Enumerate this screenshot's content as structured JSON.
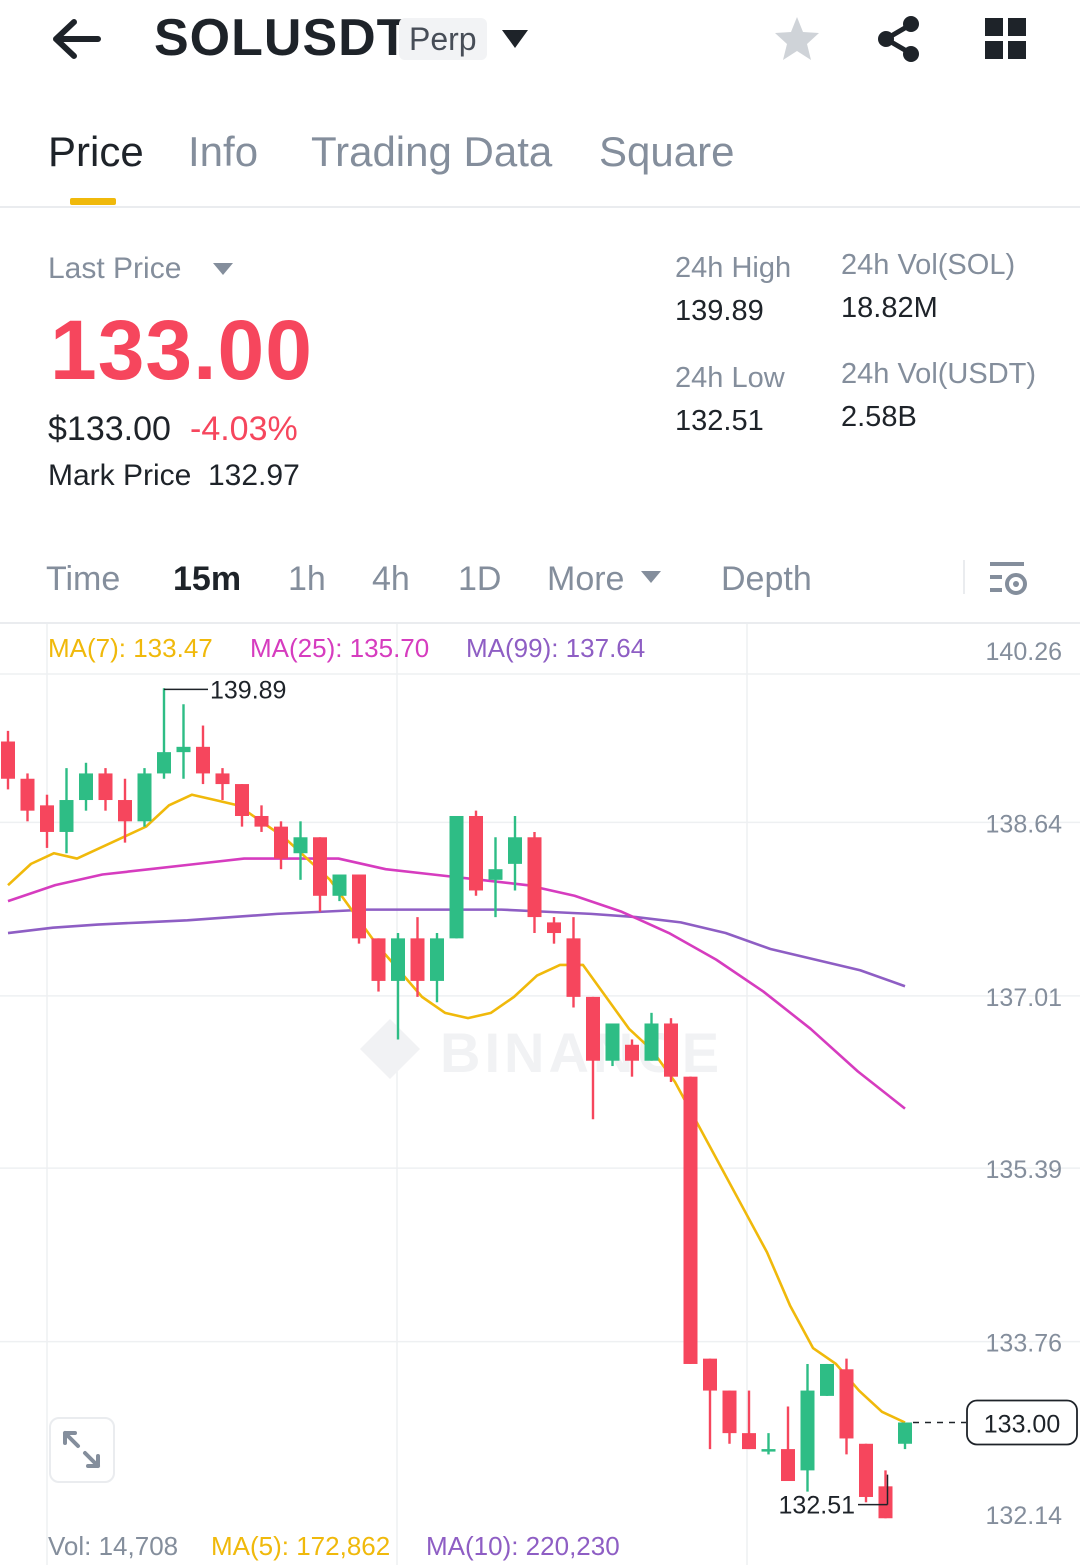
{
  "header": {
    "symbol": "SOLUSDT",
    "badge": "Perp",
    "icons": [
      "back-arrow-icon",
      "caret-down-icon",
      "star-icon",
      "share-icon",
      "grid-icon"
    ]
  },
  "tabs": [
    {
      "label": "Price",
      "active": true
    },
    {
      "label": "Info",
      "active": false
    },
    {
      "label": "Trading Data",
      "active": false
    },
    {
      "label": "Square",
      "active": false
    }
  ],
  "price": {
    "last_price_label": "Last Price",
    "last_price": "133.00",
    "usd_price": "$133.00",
    "change_pct": "-4.03%",
    "mark_price_label": "Mark Price",
    "mark_price": "132.97"
  },
  "stats": {
    "high_label": "24h High",
    "high": "139.89",
    "low_label": "24h Low",
    "low": "132.51",
    "vol_sol_label": "24h Vol(SOL)",
    "vol_sol": "18.82M",
    "vol_usdt_label": "24h Vol(USDT)",
    "vol_usdt": "2.58B"
  },
  "intervals": [
    {
      "label": "Time",
      "active": false
    },
    {
      "label": "15m",
      "active": true
    },
    {
      "label": "1h",
      "active": false
    },
    {
      "label": "4h",
      "active": false
    },
    {
      "label": "1D",
      "active": false
    },
    {
      "label": "More",
      "active": false
    },
    {
      "label": "Depth",
      "active": false
    }
  ],
  "legend": {
    "ma7": "MA(7): 133.47",
    "ma25": "MA(25): 135.70",
    "ma99": "MA(99): 137.64",
    "vol": "Vol: 14,708",
    "vol_ma5": "MA(5): 172,862",
    "vol_ma10": "MA(10): 220,230"
  },
  "colors": {
    "up": "#2ebd85",
    "down": "#f6465d",
    "accent": "#f0b90b",
    "ma7": "#f0b90b",
    "ma25": "#d63cbf",
    "ma99": "#8e5ec4"
  },
  "chart_data": {
    "type": "candlestick",
    "watermark": "BINANCE",
    "y_ticks": [
      "140.26",
      "138.64",
      "137.01",
      "135.39",
      "133.76",
      "132.14"
    ],
    "ylim": [
      132.14,
      140.26
    ],
    "high_marker": "139.89",
    "low_marker": "132.51",
    "current_price": "133.00",
    "candles": [
      {
        "o": 139.4,
        "h": 139.5,
        "c": 139.05,
        "l": 138.95
      },
      {
        "o": 139.05,
        "h": 139.1,
        "c": 138.75,
        "l": 138.65
      },
      {
        "o": 138.8,
        "h": 138.9,
        "c": 138.55,
        "l": 138.4
      },
      {
        "o": 138.55,
        "h": 139.15,
        "c": 138.85,
        "l": 138.35
      },
      {
        "o": 138.85,
        "h": 139.2,
        "c": 139.1,
        "l": 138.75
      },
      {
        "o": 139.1,
        "h": 139.15,
        "c": 138.85,
        "l": 138.75
      },
      {
        "o": 138.85,
        "h": 139.05,
        "c": 138.65,
        "l": 138.45
      },
      {
        "o": 138.65,
        "h": 139.15,
        "c": 139.1,
        "l": 138.6
      },
      {
        "o": 139.1,
        "h": 139.9,
        "c": 139.3,
        "l": 139.05
      },
      {
        "o": 139.3,
        "h": 139.75,
        "c": 139.35,
        "l": 139.05
      },
      {
        "o": 139.35,
        "h": 139.55,
        "c": 139.1,
        "l": 139.0
      },
      {
        "o": 139.1,
        "h": 139.15,
        "c": 139.0,
        "l": 138.85
      },
      {
        "o": 139.0,
        "h": 139.0,
        "c": 138.7,
        "l": 138.6
      },
      {
        "o": 138.7,
        "h": 138.8,
        "c": 138.6,
        "l": 138.55
      },
      {
        "o": 138.6,
        "h": 138.65,
        "c": 138.3,
        "l": 138.2
      },
      {
        "o": 138.35,
        "h": 138.65,
        "c": 138.5,
        "l": 138.1
      },
      {
        "o": 138.5,
        "h": 138.5,
        "c": 137.95,
        "l": 137.8
      },
      {
        "o": 137.95,
        "h": 138.15,
        "c": 138.15,
        "l": 137.9
      },
      {
        "o": 138.15,
        "h": 138.15,
        "c": 137.55,
        "l": 137.5
      },
      {
        "o": 137.55,
        "h": 137.55,
        "c": 137.15,
        "l": 137.05
      },
      {
        "o": 137.15,
        "h": 137.6,
        "c": 137.55,
        "l": 136.6
      },
      {
        "o": 137.55,
        "h": 137.75,
        "c": 137.15,
        "l": 137.0
      },
      {
        "o": 137.15,
        "h": 137.6,
        "c": 137.55,
        "l": 136.95
      },
      {
        "o": 137.55,
        "h": 138.7,
        "c": 138.7,
        "l": 137.55
      },
      {
        "o": 138.7,
        "h": 138.75,
        "c": 138.0,
        "l": 137.95
      },
      {
        "o": 138.1,
        "h": 138.5,
        "c": 138.2,
        "l": 137.75
      },
      {
        "o": 138.25,
        "h": 138.7,
        "c": 138.5,
        "l": 138.0
      },
      {
        "o": 138.5,
        "h": 138.55,
        "c": 137.75,
        "l": 137.6
      },
      {
        "o": 137.7,
        "h": 137.75,
        "c": 137.6,
        "l": 137.5
      },
      {
        "o": 137.55,
        "h": 137.75,
        "c": 137.0,
        "l": 136.9
      },
      {
        "o": 137.0,
        "h": 137.0,
        "c": 136.4,
        "l": 135.85
      },
      {
        "o": 136.4,
        "h": 136.7,
        "c": 136.75,
        "l": 136.35
      },
      {
        "o": 136.55,
        "h": 136.6,
        "c": 136.4,
        "l": 136.25
      },
      {
        "o": 136.4,
        "h": 136.85,
        "c": 136.75,
        "l": 136.4
      },
      {
        "o": 136.75,
        "h": 136.8,
        "c": 136.25,
        "l": 136.2
      },
      {
        "o": 136.25,
        "h": 136.25,
        "c": 133.55,
        "l": 133.55
      },
      {
        "o": 133.6,
        "h": 133.6,
        "c": 133.3,
        "l": 132.75
      },
      {
        "o": 133.3,
        "h": 133.3,
        "c": 132.9,
        "l": 132.8
      },
      {
        "o": 132.9,
        "h": 133.3,
        "c": 132.75,
        "l": 132.75
      },
      {
        "o": 132.75,
        "h": 132.9,
        "c": 132.75,
        "l": 132.7
      },
      {
        "o": 132.75,
        "h": 133.15,
        "c": 132.45,
        "l": 132.45
      },
      {
        "o": 132.55,
        "h": 133.55,
        "c": 133.3,
        "l": 132.35
      },
      {
        "o": 133.25,
        "h": 133.55,
        "c": 133.55,
        "l": 133.25
      },
      {
        "o": 133.5,
        "h": 133.6,
        "c": 132.85,
        "l": 132.7
      },
      {
        "o": 132.8,
        "h": 132.8,
        "c": 132.3,
        "l": 132.25
      },
      {
        "o": 132.4,
        "h": 132.55,
        "c": 132.1,
        "l": 132.1
      },
      {
        "o": 132.8,
        "h": 132.95,
        "c": 133.0,
        "l": 132.75
      }
    ],
    "ma7": [
      138.05,
      138.25,
      138.35,
      138.3,
      138.4,
      138.5,
      138.6,
      138.8,
      138.9,
      138.85,
      138.8,
      138.65,
      138.5,
      138.3,
      138.1,
      137.8,
      137.5,
      137.25,
      137.0,
      136.85,
      136.8,
      136.85,
      137.0,
      137.2,
      137.3,
      137.3,
      137.0,
      136.7,
      136.5,
      136.2,
      135.8,
      135.4,
      135.0,
      134.6,
      134.1,
      133.7,
      133.55,
      133.3,
      133.1,
      133.0
    ],
    "ma25": [
      137.9,
      138.05,
      138.15,
      138.2,
      138.25,
      138.3,
      138.3,
      138.3,
      138.2,
      138.15,
      138.1,
      138.05,
      137.95,
      137.8,
      137.6,
      137.35,
      137.05,
      136.7,
      136.3,
      135.95
    ],
    "ma99": [
      137.6,
      137.65,
      137.68,
      137.7,
      137.72,
      137.75,
      137.78,
      137.8,
      137.82,
      137.82,
      137.82,
      137.82,
      137.8,
      137.78,
      137.75,
      137.7,
      137.6,
      137.45,
      137.35,
      137.25,
      137.1
    ]
  }
}
